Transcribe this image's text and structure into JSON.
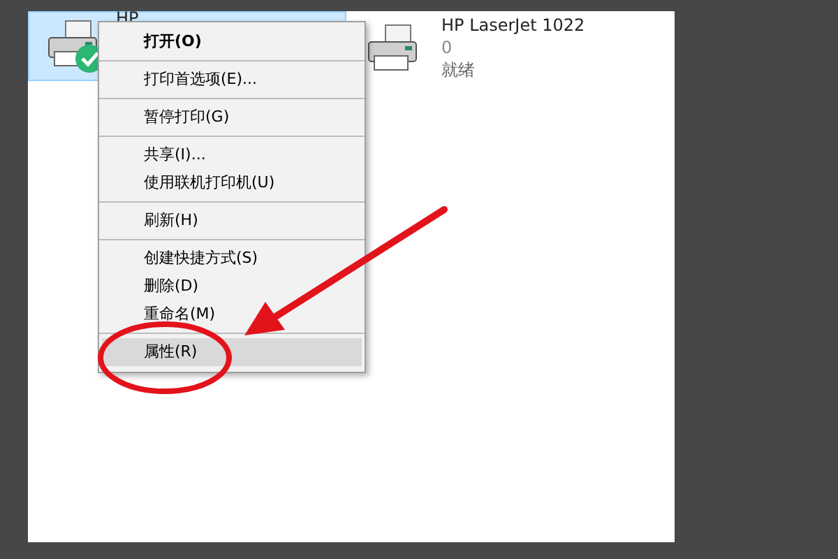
{
  "printers": [
    {
      "name": "HP",
      "selected": true,
      "default": true
    },
    {
      "name": "HP LaserJet 1022",
      "selected": false,
      "default": false,
      "documents": "0",
      "status": "就绪"
    }
  ],
  "context_menu": {
    "groups": [
      [
        {
          "label": "打开(O)",
          "bold": true,
          "selected": false
        }
      ],
      [
        {
          "label": "打印首选项(E)...",
          "bold": false,
          "selected": false
        }
      ],
      [
        {
          "label": "暂停打印(G)",
          "bold": false,
          "selected": false
        }
      ],
      [
        {
          "label": "共享(I)...",
          "bold": false,
          "selected": false
        },
        {
          "label": "使用联机打印机(U)",
          "bold": false,
          "selected": false
        }
      ],
      [
        {
          "label": "刷新(H)",
          "bold": false,
          "selected": false
        }
      ],
      [
        {
          "label": "创建快捷方式(S)",
          "bold": false,
          "selected": false
        },
        {
          "label": "删除(D)",
          "bold": false,
          "selected": false
        },
        {
          "label": "重命名(M)",
          "bold": false,
          "selected": false
        }
      ],
      [
        {
          "label": "属性(R)",
          "bold": false,
          "selected": true
        }
      ]
    ]
  }
}
